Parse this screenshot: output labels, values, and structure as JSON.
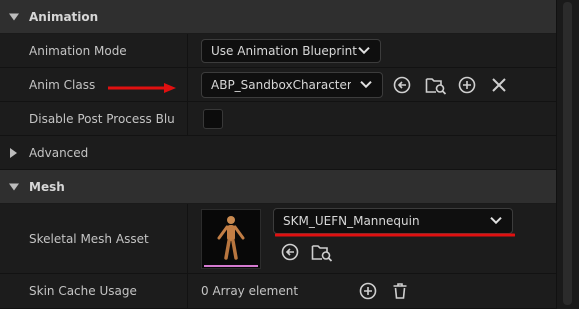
{
  "sections": {
    "animation": {
      "label": "Animation",
      "expanded": true
    },
    "advanced": {
      "label": "Advanced",
      "expanded": false
    },
    "mesh": {
      "label": "Mesh",
      "expanded": true
    }
  },
  "properties": {
    "animation_mode": {
      "label": "Animation Mode",
      "value": "Use Animation Blueprint"
    },
    "anim_class": {
      "label": "Anim Class",
      "value": "ABP_SandboxCharacter_"
    },
    "disable_post_process": {
      "label": "Disable Post Process Blu",
      "checked": false
    },
    "skeletal_mesh_asset": {
      "label": "Skeletal Mesh Asset",
      "value": "SKM_UEFN_Mannequin"
    },
    "skin_cache_usage": {
      "label": "Skin Cache Usage",
      "value": "0 Array element"
    }
  },
  "icons": {
    "anim_class": [
      "use-selected-icon",
      "browse-to-asset-icon",
      "add-icon",
      "clear-icon"
    ],
    "skeletal_mesh": [
      "use-selected-icon",
      "browse-to-asset-icon"
    ],
    "skin_cache": [
      "add-element-icon",
      "delete-icon"
    ]
  },
  "colors": {
    "annotation_red": "#e01010",
    "section_bg": "#2f2f2f",
    "row_bg": "#1c1c1c",
    "thumbnail_underline": "#d47ad0"
  }
}
